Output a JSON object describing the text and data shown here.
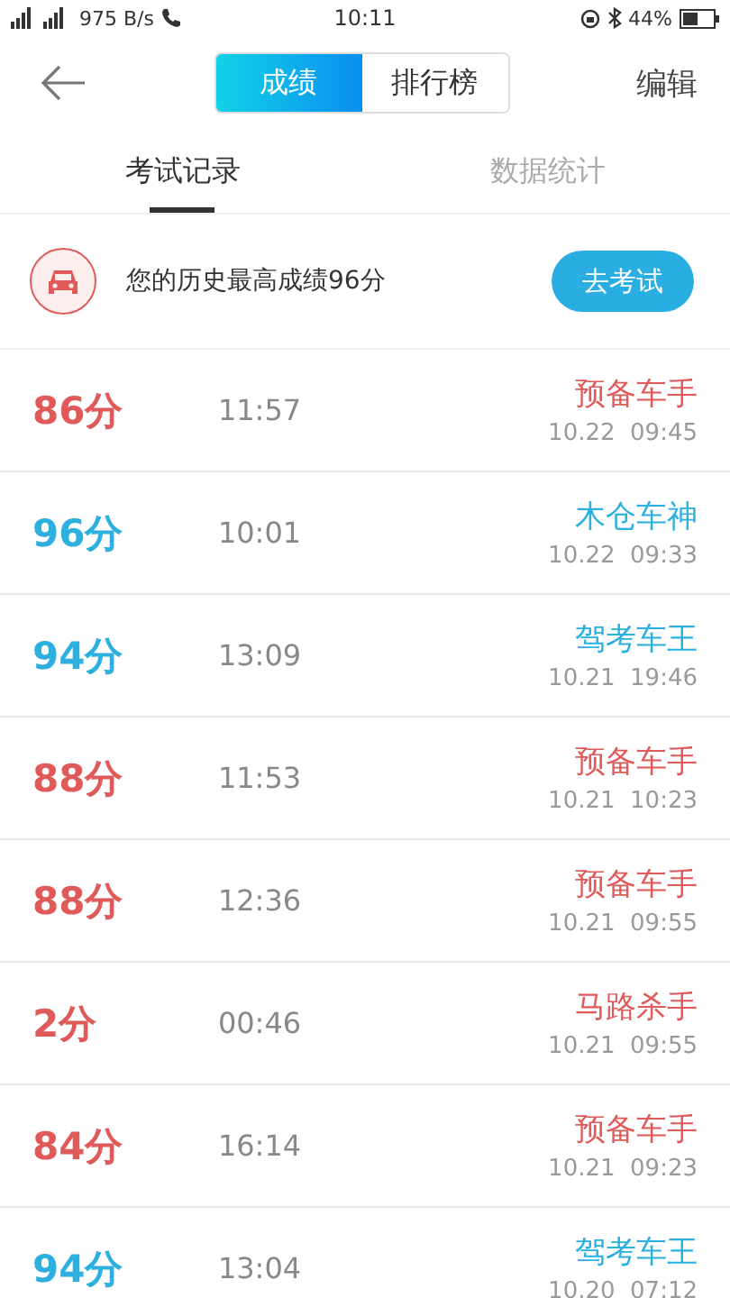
{
  "status_bar": {
    "speed": "975 B/s",
    "time": "10:11",
    "battery": "44%"
  },
  "header": {
    "segments": [
      {
        "label": "成绩",
        "selected": true
      },
      {
        "label": "排行榜",
        "selected": false
      }
    ],
    "action": "编辑"
  },
  "tabs": [
    {
      "label": "考试记录",
      "selected": true
    },
    {
      "label": "数据统计",
      "selected": false
    }
  ],
  "best": {
    "text": "您的历史最高成绩96分",
    "button": "去考试"
  },
  "records": [
    {
      "score": "86分",
      "duration": "11:57",
      "title": "预备车手",
      "date": "10.22  09:45",
      "color": "#e05a5a"
    },
    {
      "score": "96分",
      "duration": "10:01",
      "title": "木仓车神",
      "date": "10.22  09:33",
      "color": "#2bb0e0"
    },
    {
      "score": "94分",
      "duration": "13:09",
      "title": "驾考车王",
      "date": "10.21  19:46",
      "color": "#2bb0e0"
    },
    {
      "score": "88分",
      "duration": "11:53",
      "title": "预备车手",
      "date": "10.21  10:23",
      "color": "#e05a5a"
    },
    {
      "score": "88分",
      "duration": "12:36",
      "title": "预备车手",
      "date": "10.21  09:55",
      "color": "#e05a5a"
    },
    {
      "score": "2分",
      "duration": "00:46",
      "title": "马路杀手",
      "date": "10.21  09:55",
      "color": "#e05a5a"
    },
    {
      "score": "84分",
      "duration": "16:14",
      "title": "预备车手",
      "date": "10.21  09:23",
      "color": "#e05a5a"
    },
    {
      "score": "94分",
      "duration": "13:04",
      "title": "驾考车王",
      "date": "10.20  07:12",
      "color": "#2bb0e0"
    }
  ]
}
